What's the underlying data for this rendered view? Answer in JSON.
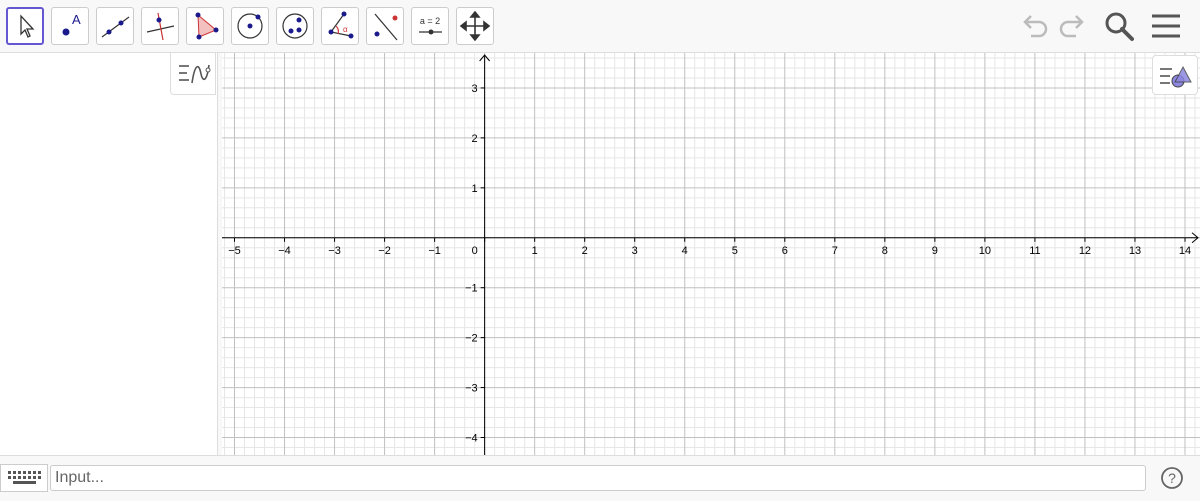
{
  "toolbar": {
    "tools": [
      {
        "id": "move",
        "icon": "move-arrow-icon",
        "active": true
      },
      {
        "id": "point",
        "icon": "point-icon",
        "label": "A"
      },
      {
        "id": "line",
        "icon": "line-icon"
      },
      {
        "id": "perpendicular",
        "icon": "perpendicular-line-icon"
      },
      {
        "id": "polygon",
        "icon": "polygon-icon"
      },
      {
        "id": "circle",
        "icon": "circle-center-point-icon"
      },
      {
        "id": "circle3",
        "icon": "circle-three-points-icon"
      },
      {
        "id": "angle",
        "icon": "angle-icon",
        "label": "α"
      },
      {
        "id": "reflect",
        "icon": "reflect-line-icon"
      },
      {
        "id": "slider",
        "icon": "slider-icon",
        "label": "a = 2"
      },
      {
        "id": "movegraphics",
        "icon": "move-graphics-icon"
      }
    ],
    "right": [
      "undo-icon",
      "redo-icon",
      "search-icon",
      "menu-icon"
    ]
  },
  "graphics": {
    "x_min": -5.25,
    "x_max": 14.3,
    "y_min": -4.35,
    "y_max": 3.7,
    "x_ticks": [
      -5,
      -4,
      -3,
      -2,
      -1,
      0,
      1,
      2,
      3,
      4,
      5,
      6,
      7,
      8,
      9,
      10,
      11,
      12,
      13,
      14
    ],
    "y_ticks": [
      3,
      2,
      1,
      -1,
      -2,
      -3,
      -4
    ],
    "x_tick_labels": [
      "−5",
      "−4",
      "−3",
      "−2",
      "−1",
      "0",
      "1",
      "2",
      "3",
      "4",
      "5",
      "6",
      "7",
      "8",
      "9",
      "10",
      "11",
      "12",
      "13",
      "14"
    ],
    "y_tick_labels": [
      "3",
      "2",
      "1",
      "−1",
      "−2",
      "−3",
      "−4"
    ],
    "grid_major": "#c0c0c0",
    "grid_minor": "#e6e6e6",
    "axis_color": "#000000"
  },
  "input": {
    "placeholder": "Input..."
  },
  "help_label": "?",
  "colors": {
    "accent": "#6557d2",
    "point": "#1a1a8c",
    "polygon": "#f4bfbf"
  }
}
